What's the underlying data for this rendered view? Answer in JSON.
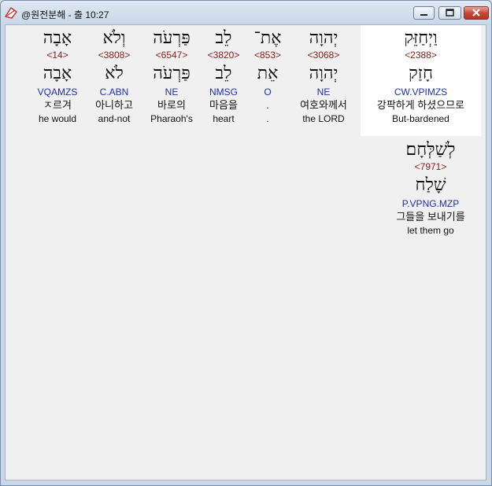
{
  "window": {
    "title": "@원전분해 - 출 10:27"
  },
  "words": [
    {
      "hebrew": "וַיְחַזֵּק",
      "strong": "<2388>",
      "lemma": "חָזַק",
      "morph": "CW.VPIMZS",
      "korean": "강팍하게 하셨으므로",
      "english": "But-bardened"
    },
    {
      "hebrew": "יְהוָה",
      "strong": "<3068>",
      "lemma": "יְהוָה",
      "morph": "NE",
      "korean": "여호와께서",
      "english": "the LORD"
    },
    {
      "hebrew": "אֶת־",
      "strong": "<853>",
      "lemma": "אֵת",
      "morph": "O",
      "korean": ".",
      "english": "."
    },
    {
      "hebrew": "לֵב",
      "strong": "<3820>",
      "lemma": "לֵב",
      "morph": "NMSG",
      "korean": "마음을",
      "english": "heart"
    },
    {
      "hebrew": "פַּרְעֹה",
      "strong": "<6547>",
      "lemma": "פַּרְעֹה",
      "morph": "NE",
      "korean": "바로의",
      "english": "Pharaoh's"
    },
    {
      "hebrew": "וְלֹא",
      "strong": "<3808>",
      "lemma": "לֹא",
      "morph": "C.ABN",
      "korean": "아니하고",
      "english": "and-not"
    },
    {
      "hebrew": "אָבָה",
      "strong": "<14>",
      "lemma": "אָבָה",
      "morph": "VQAMZS",
      "korean": "ㅈ르겨",
      "english": "he would"
    },
    {
      "hebrew": "לְשַׁלְּחָם׃",
      "strong": "<7971>",
      "lemma": "שָׁלַח",
      "morph": "P.VPNG.MZP",
      "korean": "그들을 보내기를",
      "english": "let them go"
    }
  ]
}
